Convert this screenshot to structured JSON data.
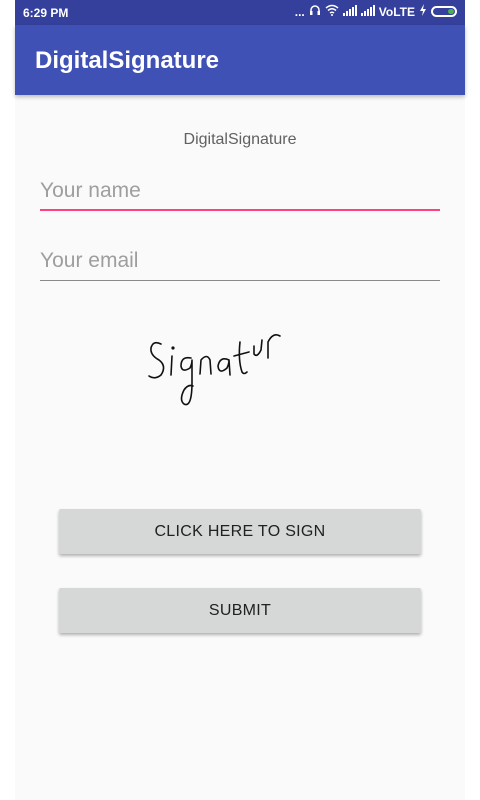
{
  "status_bar": {
    "time": "6:29 PM",
    "dots": "...",
    "network": "VoLTE",
    "icons": [
      "headphones-icon",
      "wifi-icon",
      "signal-icon",
      "signal-icon",
      "charging-icon",
      "battery-icon"
    ]
  },
  "app_bar": {
    "title": "DigitalSignature"
  },
  "form": {
    "heading": "DigitalSignature",
    "name_placeholder": "Your name",
    "email_placeholder": "Your email",
    "signature_text": "Signatur",
    "sign_button_label": "CLICK HERE TO SIGN",
    "submit_button_label": "SUBMIT"
  },
  "colors": {
    "app_bar": "#3f51b5",
    "status_bar": "#34409c",
    "accent": "#ff4081",
    "button": "#d6d7d7"
  }
}
